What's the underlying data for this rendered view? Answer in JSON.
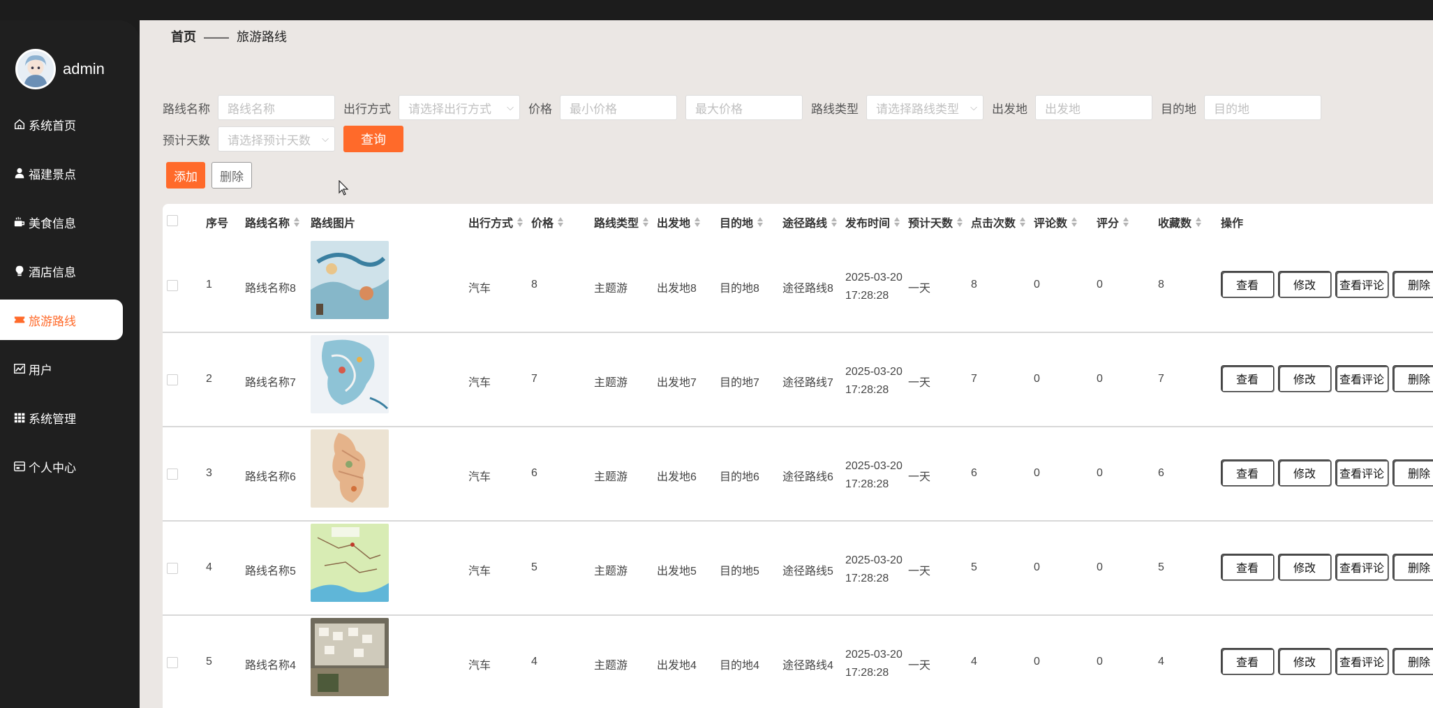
{
  "profile": {
    "name": "admin"
  },
  "breadcrumb": {
    "home": "首页",
    "sep": "——",
    "current": "旅游路线"
  },
  "menu": [
    {
      "label": "系统首页",
      "icon": "home-icon"
    },
    {
      "label": "福建景点",
      "icon": "user-icon"
    },
    {
      "label": "美食信息",
      "icon": "coffee-icon"
    },
    {
      "label": "酒店信息",
      "icon": "bulb-icon"
    },
    {
      "label": "旅游路线",
      "icon": "ticket-icon",
      "active": true
    },
    {
      "label": "用户",
      "icon": "chart-icon"
    },
    {
      "label": "系统管理",
      "icon": "grid-icon"
    },
    {
      "label": "个人中心",
      "icon": "card-icon"
    }
  ],
  "filters": {
    "route_name_label": "路线名称",
    "route_name_placeholder": "路线名称",
    "travel_mode_label": "出行方式",
    "travel_mode_placeholder": "请选择出行方式",
    "price_label": "价格",
    "min_price_placeholder": "最小价格",
    "max_price_placeholder": "最大价格",
    "route_type_label": "路线类型",
    "route_type_placeholder": "请选择路线类型",
    "origin_label": "出发地",
    "origin_placeholder": "出发地",
    "destination_label": "目的地",
    "destination_placeholder": "目的地",
    "days_label": "预计天数",
    "days_placeholder": "请选择预计天数",
    "query_button": "查询"
  },
  "toolbar": {
    "add": "添加",
    "delete": "删除"
  },
  "table": {
    "headers": {
      "index": "序号",
      "name": "路线名称",
      "image": "路线图片",
      "mode": "出行方式",
      "price": "价格",
      "type": "路线类型",
      "origin": "出发地",
      "dest": "目的地",
      "via": "途径路线",
      "time": "发布时间",
      "days": "预计天数",
      "clicks": "点击次数",
      "comments": "评论数",
      "score": "评分",
      "favs": "收藏数",
      "ops": "操作"
    },
    "actions": {
      "view": "查看",
      "edit": "修改",
      "view_comments": "查看评论",
      "delete": "删除"
    },
    "rows": [
      {
        "index": "1",
        "name": "路线名称8",
        "mode": "汽车",
        "price": "8",
        "type": "主题游",
        "origin": "出发地8",
        "dest": "目的地8",
        "via": "途径路线8",
        "time": "2025-03-20 17:28:28",
        "days": "一天",
        "clicks": "8",
        "comments": "0",
        "score": "0",
        "favs": "8"
      },
      {
        "index": "2",
        "name": "路线名称7",
        "mode": "汽车",
        "price": "7",
        "type": "主题游",
        "origin": "出发地7",
        "dest": "目的地7",
        "via": "途径路线7",
        "time": "2025-03-20 17:28:28",
        "days": "一天",
        "clicks": "7",
        "comments": "0",
        "score": "0",
        "favs": "7"
      },
      {
        "index": "3",
        "name": "路线名称6",
        "mode": "汽车",
        "price": "6",
        "type": "主题游",
        "origin": "出发地6",
        "dest": "目的地6",
        "via": "途径路线6",
        "time": "2025-03-20 17:28:28",
        "days": "一天",
        "clicks": "6",
        "comments": "0",
        "score": "0",
        "favs": "6"
      },
      {
        "index": "4",
        "name": "路线名称5",
        "mode": "汽车",
        "price": "5",
        "type": "主题游",
        "origin": "出发地5",
        "dest": "目的地5",
        "via": "途径路线5",
        "time": "2025-03-20 17:28:28",
        "days": "一天",
        "clicks": "5",
        "comments": "0",
        "score": "0",
        "favs": "5"
      },
      {
        "index": "5",
        "name": "路线名称4",
        "mode": "汽车",
        "price": "4",
        "type": "主题游",
        "origin": "出发地4",
        "dest": "目的地4",
        "via": "途径路线4",
        "time": "2025-03-20 17:28:28",
        "days": "一天",
        "clicks": "4",
        "comments": "0",
        "score": "0",
        "favs": "4"
      }
    ]
  },
  "colors": {
    "accent": "#ff6a2a",
    "sidebar": "#1f1f1f",
    "content_bg": "#ebe7e4"
  }
}
